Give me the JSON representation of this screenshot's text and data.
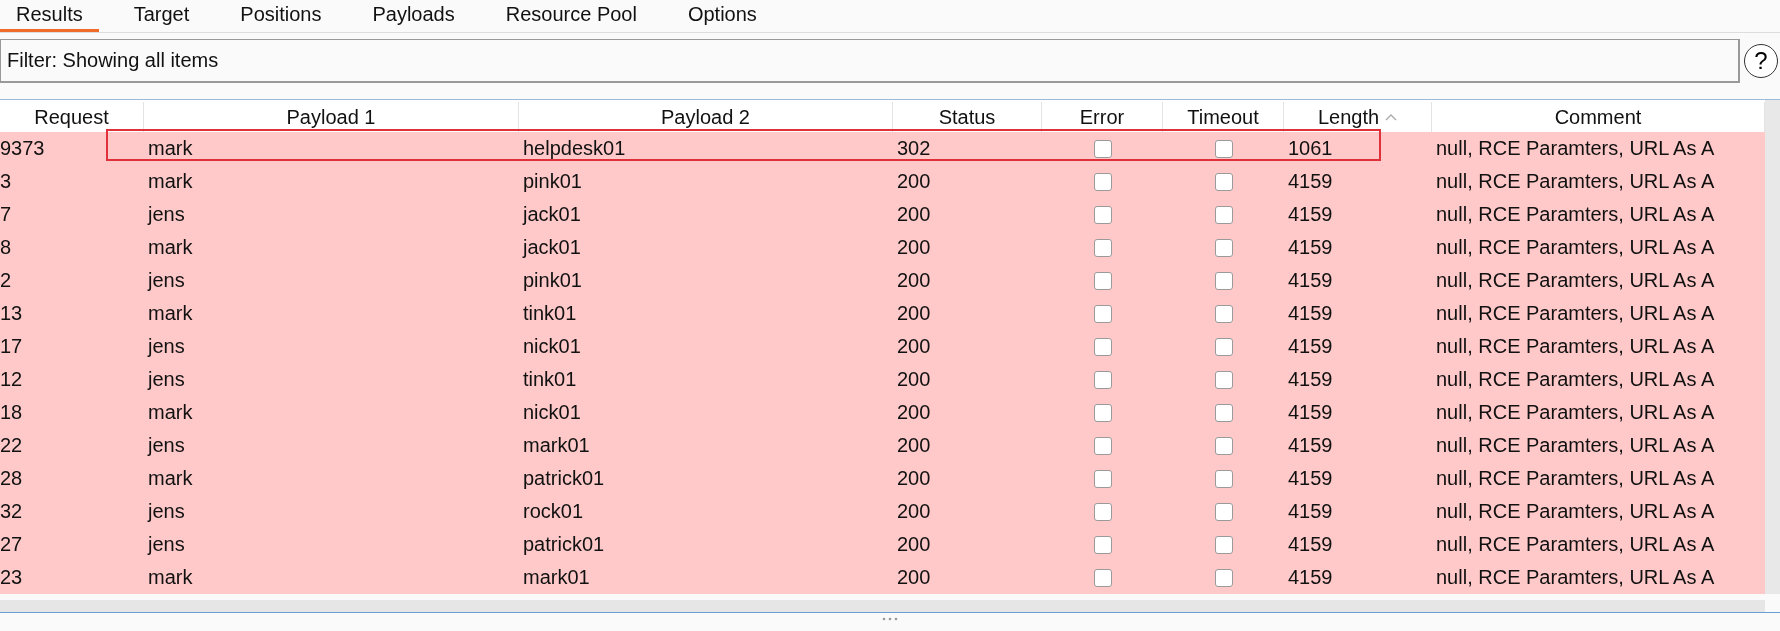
{
  "tabs": [
    {
      "label": "Results",
      "selected": true
    },
    {
      "label": "Target",
      "selected": false
    },
    {
      "label": "Positions",
      "selected": false
    },
    {
      "label": "Payloads",
      "selected": false
    },
    {
      "label": "Resource Pool",
      "selected": false
    },
    {
      "label": "Options",
      "selected": false
    }
  ],
  "filter": {
    "value": "Filter: Showing all items",
    "help": "?"
  },
  "table": {
    "columns": [
      {
        "label": "Request",
        "sorted": false
      },
      {
        "label": "Payload 1",
        "sorted": false
      },
      {
        "label": "Payload 2",
        "sorted": false
      },
      {
        "label": "Status",
        "sorted": false
      },
      {
        "label": "Error",
        "sorted": false
      },
      {
        "label": "Timeout",
        "sorted": false
      },
      {
        "label": "Length",
        "sorted": true
      },
      {
        "label": "Comment",
        "sorted": false
      }
    ],
    "rows": [
      {
        "request": "9373",
        "payload_1": "mark",
        "payload_2": "helpdesk01",
        "status": "302",
        "error": false,
        "timeout": false,
        "length": "1061",
        "comment": "null, RCE Paramters, URL As A",
        "outlined": true
      },
      {
        "request": "3",
        "payload_1": "mark",
        "payload_2": "pink01",
        "status": "200",
        "error": false,
        "timeout": false,
        "length": "4159",
        "comment": "null, RCE Paramters, URL As A",
        "outlined": false
      },
      {
        "request": "7",
        "payload_1": "jens",
        "payload_2": "jack01",
        "status": "200",
        "error": false,
        "timeout": false,
        "length": "4159",
        "comment": "null, RCE Paramters, URL As A",
        "outlined": false
      },
      {
        "request": "8",
        "payload_1": "mark",
        "payload_2": "jack01",
        "status": "200",
        "error": false,
        "timeout": false,
        "length": "4159",
        "comment": "null, RCE Paramters, URL As A",
        "outlined": false
      },
      {
        "request": "2",
        "payload_1": "jens",
        "payload_2": "pink01",
        "status": "200",
        "error": false,
        "timeout": false,
        "length": "4159",
        "comment": "null, RCE Paramters, URL As A",
        "outlined": false
      },
      {
        "request": "13",
        "payload_1": "mark",
        "payload_2": "tink01",
        "status": "200",
        "error": false,
        "timeout": false,
        "length": "4159",
        "comment": "null, RCE Paramters, URL As A",
        "outlined": false
      },
      {
        "request": "17",
        "payload_1": "jens",
        "payload_2": "nick01",
        "status": "200",
        "error": false,
        "timeout": false,
        "length": "4159",
        "comment": "null, RCE Paramters, URL As A",
        "outlined": false
      },
      {
        "request": "12",
        "payload_1": "jens",
        "payload_2": "tink01",
        "status": "200",
        "error": false,
        "timeout": false,
        "length": "4159",
        "comment": "null, RCE Paramters, URL As A",
        "outlined": false
      },
      {
        "request": "18",
        "payload_1": "mark",
        "payload_2": "nick01",
        "status": "200",
        "error": false,
        "timeout": false,
        "length": "4159",
        "comment": "null, RCE Paramters, URL As A",
        "outlined": false
      },
      {
        "request": "22",
        "payload_1": "jens",
        "payload_2": "mark01",
        "status": "200",
        "error": false,
        "timeout": false,
        "length": "4159",
        "comment": "null, RCE Paramters, URL As A",
        "outlined": false
      },
      {
        "request": "28",
        "payload_1": "mark",
        "payload_2": "patrick01",
        "status": "200",
        "error": false,
        "timeout": false,
        "length": "4159",
        "comment": "null, RCE Paramters, URL As A",
        "outlined": false
      },
      {
        "request": "32",
        "payload_1": "jens",
        "payload_2": "rock01",
        "status": "200",
        "error": false,
        "timeout": false,
        "length": "4159",
        "comment": "null, RCE Paramters, URL As A",
        "outlined": false
      },
      {
        "request": "27",
        "payload_1": "jens",
        "payload_2": "patrick01",
        "status": "200",
        "error": false,
        "timeout": false,
        "length": "4159",
        "comment": "null, RCE Paramters, URL As A",
        "outlined": false
      },
      {
        "request": "23",
        "payload_1": "mark",
        "payload_2": "mark01",
        "status": "200",
        "error": false,
        "timeout": false,
        "length": "4159",
        "comment": "null, RCE Paramters, URL As A",
        "outlined": false
      }
    ]
  }
}
